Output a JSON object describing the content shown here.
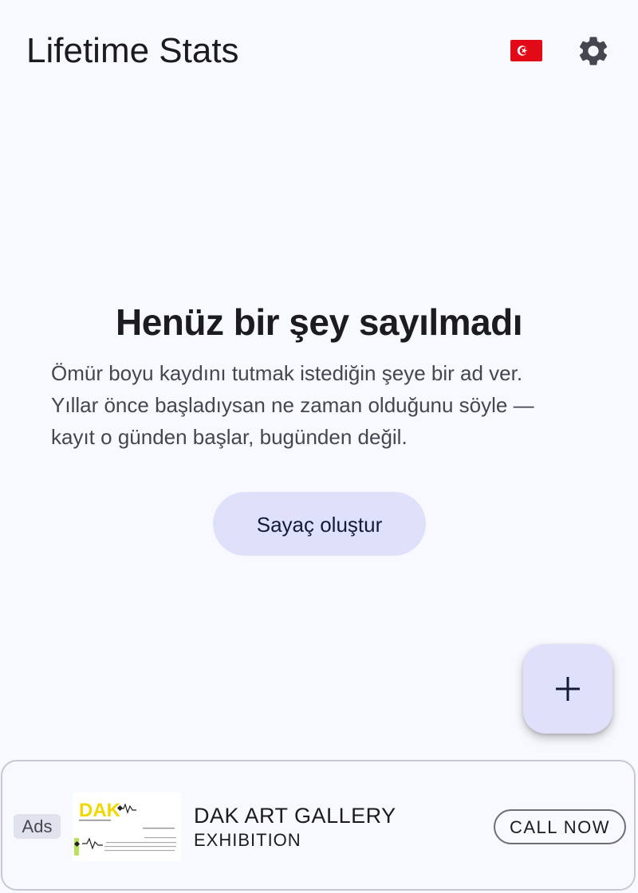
{
  "header": {
    "title": "Lifetime Stats",
    "language_flag_icon": "turkey-flag-icon",
    "settings_icon": "gear-icon"
  },
  "empty_state": {
    "title": "Henüz bir şey sayılmadı",
    "body_lines": [
      "Ömür boyu kaydını tutmak istediğin şeye bir ad ver.",
      "Yıllar önce başladıysan ne zaman olduğunu söyle —",
      "kayıt o günden başlar, bugünden değil."
    ],
    "create_button_label": "Sayaç oluştur"
  },
  "fab": {
    "icon": "plus-icon"
  },
  "ad": {
    "badge": "Ads",
    "title": "DAK ART GALLERY",
    "subtitle": "EXHIBITION",
    "cta": "CALL NOW",
    "thumbnail_logo_text": "DAK"
  },
  "colors": {
    "background": "#f8f9fe",
    "container": "#dfe1fb",
    "on_surface": "#1b1b21",
    "flag_red": "#e30a17"
  }
}
